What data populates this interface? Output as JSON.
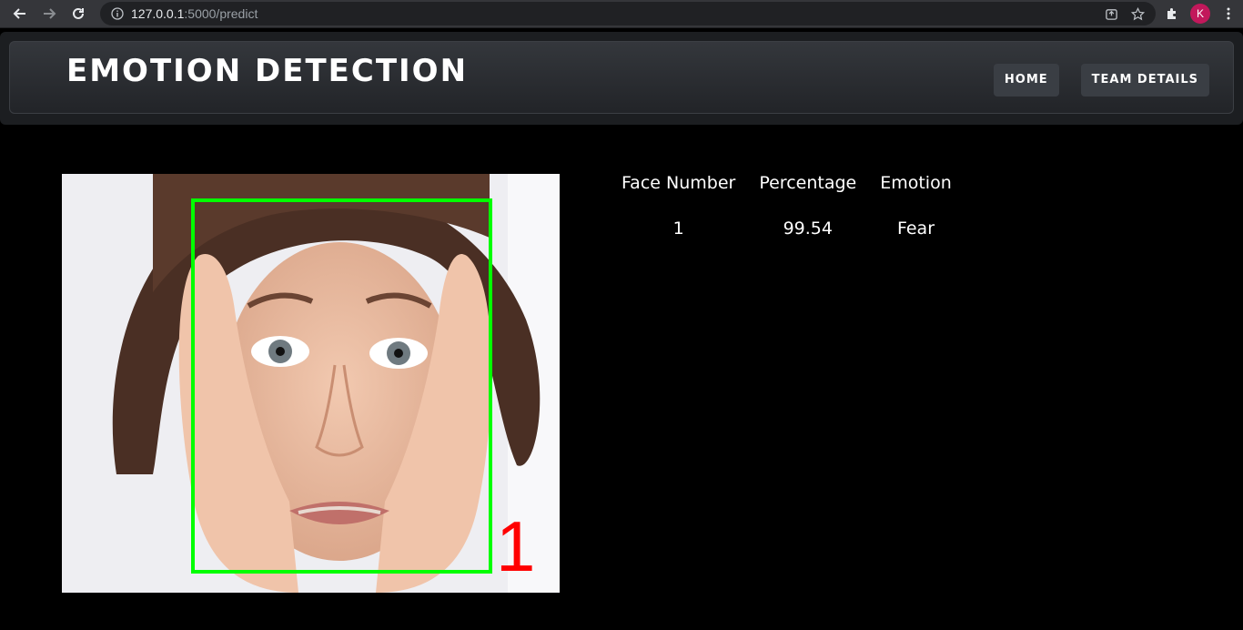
{
  "browser": {
    "url_host": "127.0.0.1",
    "url_path": ":5000/predict",
    "avatar_letter": "K",
    "avatar_color": "#c2185b"
  },
  "site": {
    "title": "EMOTION DETECTION",
    "nav": [
      {
        "label": "HOME"
      },
      {
        "label": "TEAM DETAILS"
      }
    ]
  },
  "result": {
    "face_box_label": "1",
    "face_box_color": "#00ff00",
    "face_label_color": "#ff0000",
    "table": {
      "headers": [
        "Face Number",
        "Percentage",
        "Emotion"
      ],
      "rows": [
        [
          "1",
          "99.54",
          "Fear"
        ]
      ]
    }
  }
}
